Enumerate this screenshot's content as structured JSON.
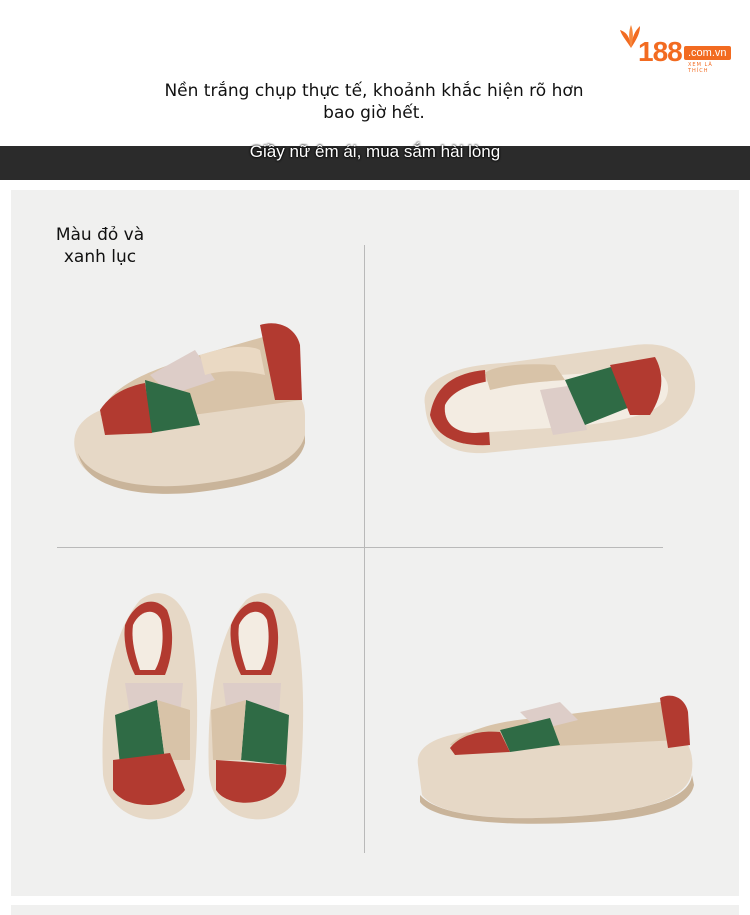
{
  "brand": {
    "logo_number": "188",
    "logo_domain": ".com.vn",
    "logo_tagline": "XEM LÀ THÍCH"
  },
  "intro_text": "Nền trắng chụp thực tế, khoảnh khắc hiện rõ hơn bao giờ hết.",
  "banner_text": "Giầy nữ êm ái, mua sắm hài lòng",
  "color_label": "Màu đỏ và xanh lục",
  "colors": {
    "accent": "#f26b21",
    "band": "#2b2b2b",
    "panel": "#f0f0ef",
    "shoe_red": "#b23a30",
    "shoe_green": "#2f6b45",
    "shoe_tan": "#d8c3a8",
    "shoe_pink": "#ddcdc8",
    "sole": "#e6d8c6"
  }
}
